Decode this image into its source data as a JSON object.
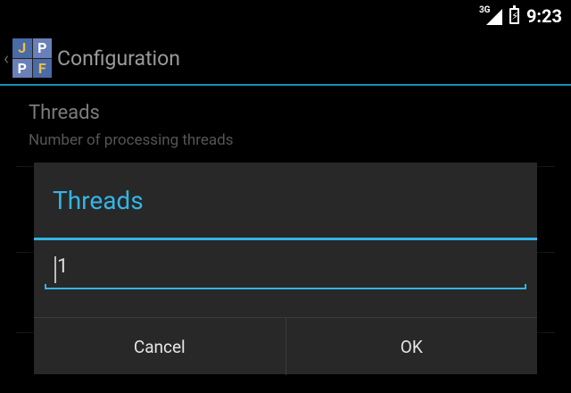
{
  "status_bar": {
    "network": "3G",
    "time": "9:23"
  },
  "action_bar": {
    "title": "Configuration",
    "icon_letters": [
      "J",
      "P",
      "P",
      "F"
    ]
  },
  "preferences": [
    {
      "title": "Threads",
      "summary": "Number of processing threads"
    }
  ],
  "dialog": {
    "title": "Threads",
    "input_value": "1",
    "cancel_label": "Cancel",
    "ok_label": "OK"
  },
  "colors": {
    "accent": "#33b5e5",
    "dialog_bg": "#282828",
    "background": "#000000"
  }
}
